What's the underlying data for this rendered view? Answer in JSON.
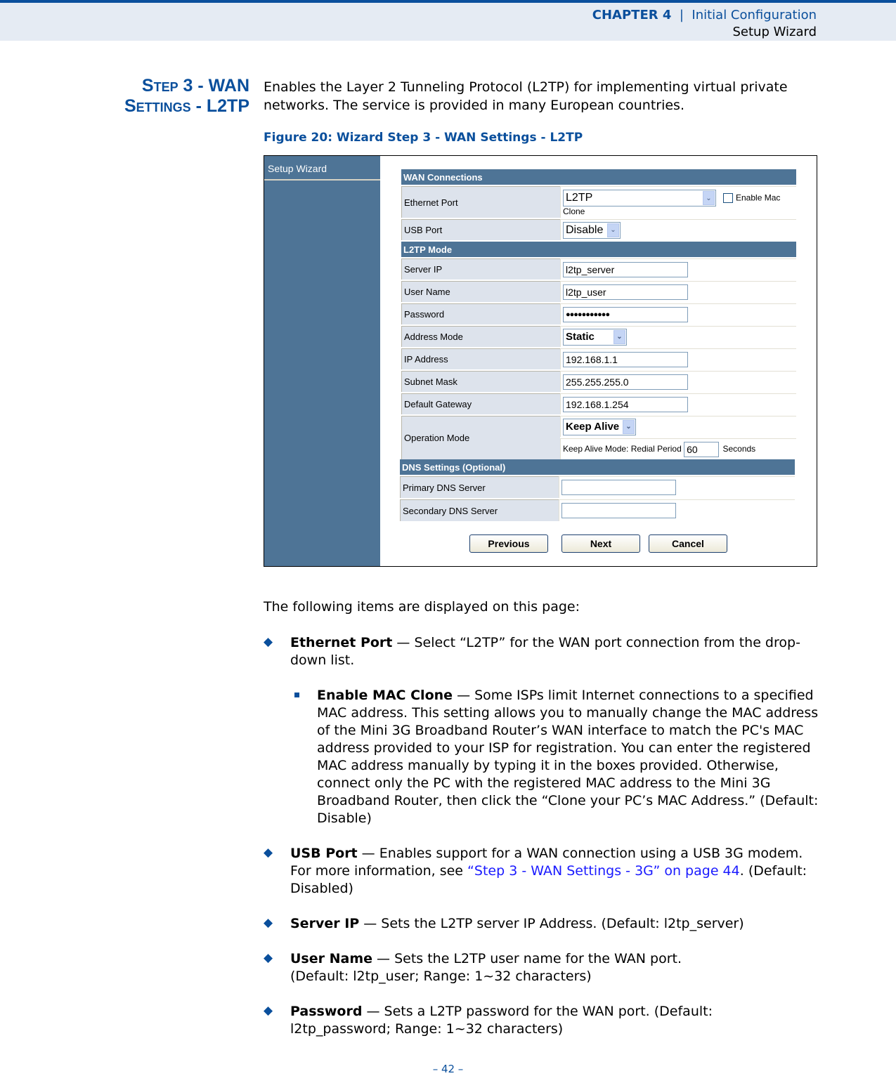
{
  "header": {
    "chapter": "CHAPTER 4",
    "separator": "|",
    "chapter_title": "Initial Configuration",
    "section": "Setup Wizard"
  },
  "side_heading": {
    "line1": "Step 3 - WAN",
    "line2": "Settings - L2TP"
  },
  "intro": "Enables the Layer 2 Tunneling Protocol (L2TP) for implementing virtual private networks. The service is provided in many European countries.",
  "figure_caption": "Figure 20:  Wizard Step 3 - WAN Settings - L2TP",
  "screenshot": {
    "sidebar_title": "Setup Wizard",
    "wan_connections": {
      "header": "WAN Connections",
      "ethernet_port": {
        "label": "Ethernet Port",
        "value": "L2TP",
        "checkbox_label_1": "Enable Mac",
        "checkbox_label_2": "Clone",
        "checked": false
      },
      "usb_port": {
        "label": "USB Port",
        "value": "Disable"
      }
    },
    "l2tp_mode": {
      "header": "L2TP Mode",
      "server_ip": {
        "label": "Server IP",
        "value": "l2tp_server"
      },
      "user_name": {
        "label": "User Name",
        "value": "l2tp_user"
      },
      "password": {
        "label": "Password",
        "value": "●●●●●●●●●●●"
      },
      "address_mode": {
        "label": "Address Mode",
        "value": "Static"
      },
      "ip_address": {
        "label": "IP Address",
        "value": "192.168.1.1"
      },
      "subnet_mask": {
        "label": "Subnet Mask",
        "value": "255.255.255.0"
      },
      "default_gateway": {
        "label": "Default Gateway",
        "value": "192.168.1.254"
      },
      "operation_mode": {
        "label": "Operation Mode",
        "value": "Keep Alive",
        "redial_label": "Keep Alive Mode: Redial Period",
        "redial_value": "60",
        "redial_unit": "Seconds"
      }
    },
    "dns": {
      "header": "DNS Settings (Optional)",
      "primary": {
        "label": "Primary DNS Server",
        "value": ""
      },
      "secondary": {
        "label": "Secondary DNS Server",
        "value": ""
      }
    },
    "buttons": {
      "previous": "Previous",
      "next": "Next",
      "cancel": "Cancel"
    }
  },
  "items_intro": "The following items are displayed on this page:",
  "items": [
    {
      "term": "Ethernet Port",
      "text": " — Select “L2TP” for the WAN port connection from the drop-down list."
    },
    {
      "term": "Enable MAC Clone",
      "text": " — Some ISPs limit Internet connections to a specified MAC address. This setting allows you to manually change the MAC address of the Mini 3G Broadband Router’s WAN interface to match the PC's MAC address provided to your ISP for registration. You can enter the registered MAC address manually by typing it in the boxes provided. Otherwise, connect only the PC with the registered MAC address to the Mini 3G Broadband Router, then click the “Clone your PC’s MAC Address.” (Default: Disable)"
    },
    {
      "term": "USB Port",
      "text_before": " — Enables support for a WAN connection using a USB 3G modem. For more information, see ",
      "link": "“Step 3 - WAN Settings - 3G” on page 44",
      "text_after": ". (Default: Disabled)"
    },
    {
      "term": "Server IP",
      "text": " — Sets the L2TP server IP Address. (Default: l2tp_server)"
    },
    {
      "term": "User Name",
      "text": " — Sets the L2TP user name for the WAN port. (Default: l2tp_user; Range: 1~32 characters)"
    },
    {
      "term": "Password",
      "text": " — Sets a L2TP password for the WAN port. (Default: l2tp_password; Range: 1~32 characters)"
    }
  ],
  "page_number": "–  42  –"
}
